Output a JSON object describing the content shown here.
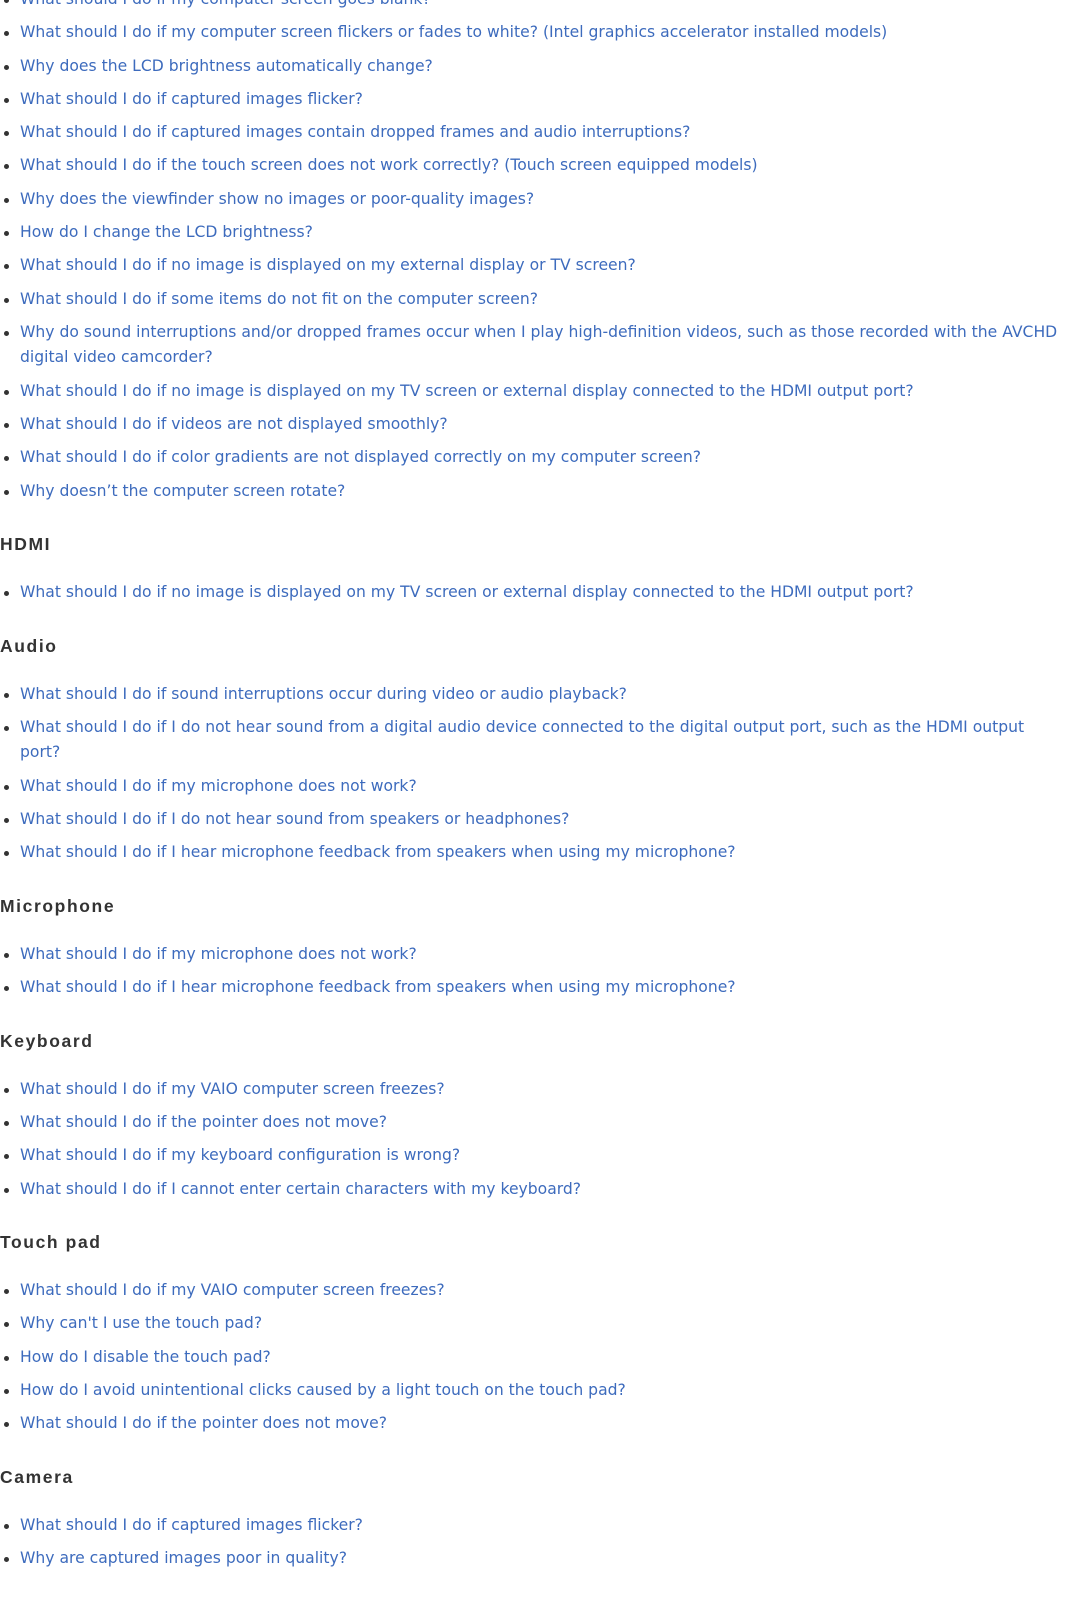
{
  "colors": {
    "link": "#3d6bbd",
    "heading": "#333333",
    "bullet": "#333333"
  },
  "display_links": [
    "What should I do if my computer screen goes blank?",
    "What should I do if my computer screen flickers or fades to white? (Intel graphics accelerator installed models)",
    "Why does the LCD brightness automatically change?",
    "What should I do if captured images flicker?",
    "What should I do if captured images contain dropped frames and audio interruptions?",
    "What should I do if the touch screen does not work correctly? (Touch screen equipped models)",
    "Why does the viewfinder show no images or poor-quality images?",
    "How do I change the LCD brightness?",
    "What should I do if no image is displayed on my external display or TV screen?",
    "What should I do if some items do not fit on the computer screen?",
    "Why do sound interruptions and/or dropped frames occur when I play high-definition videos, such as those recorded with the AVCHD digital video camcorder?",
    "What should I do if no image is displayed on my TV screen or external display connected to the HDMI output port?",
    "What should I do if videos are not displayed smoothly?",
    "What should I do if color gradients are not displayed correctly on my computer screen?",
    "Why doesn’t the computer screen rotate?"
  ],
  "sections": {
    "hdmi": {
      "title": "HDMI",
      "links": [
        "What should I do if no image is displayed on my TV screen or external display connected to the HDMI output port?"
      ]
    },
    "audio": {
      "title": "Audio",
      "links": [
        "What should I do if sound interruptions occur during video or audio playback?",
        "What should I do if I do not hear sound from a digital audio device connected to the digital output port, such as the HDMI output port?",
        "What should I do if my microphone does not work?",
        "What should I do if I do not hear sound from speakers or headphones?",
        "What should I do if I hear microphone feedback from speakers when using my microphone?"
      ]
    },
    "microphone": {
      "title": "Microphone",
      "links": [
        "What should I do if my microphone does not work?",
        "What should I do if I hear microphone feedback from speakers when using my microphone?"
      ]
    },
    "keyboard": {
      "title": "Keyboard",
      "links": [
        "What should I do if my VAIO computer screen freezes?",
        "What should I do if the pointer does not move?",
        "What should I do if my keyboard configuration is wrong?",
        "What should I do if I cannot enter certain characters with my keyboard?"
      ]
    },
    "touchpad": {
      "title": "Touch pad",
      "links": [
        "What should I do if my VAIO computer screen freezes?",
        "Why can't I use the touch pad?",
        "How do I disable the touch pad?",
        "How do I avoid unintentional clicks caused by a light touch on the touch pad?",
        "What should I do if the pointer does not move?"
      ]
    },
    "camera": {
      "title": "Camera",
      "links": [
        "What should I do if captured images flicker?",
        "Why are captured images poor in quality?"
      ]
    }
  }
}
